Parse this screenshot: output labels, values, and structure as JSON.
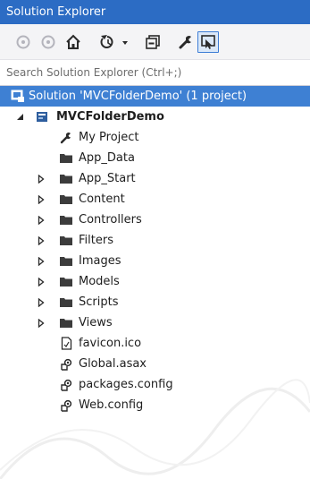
{
  "window": {
    "title": "Solution Explorer"
  },
  "toolbar": {
    "buttons": [
      {
        "icon": "back-icon"
      },
      {
        "icon": "forward-icon"
      },
      {
        "icon": "home-icon"
      },
      {
        "icon": "history-dropdown-icon"
      },
      {
        "icon": "collapse-all-icon"
      },
      {
        "icon": "properties-wrench-icon"
      },
      {
        "icon": "preview-selected-icon",
        "selected": true
      }
    ]
  },
  "search": {
    "placeholder": "Search Solution Explorer (Ctrl+;)"
  },
  "tree": {
    "solution": {
      "label": "Solution 'MVCFolderDemo' (1 project)"
    },
    "project": {
      "label": "MVCFolderDemo"
    },
    "items": [
      {
        "label": "My Project",
        "icon": "wrench-icon",
        "expandable": false
      },
      {
        "label": "App_Data",
        "icon": "folder-icon",
        "expandable": false
      },
      {
        "label": "App_Start",
        "icon": "folder-icon",
        "expandable": true
      },
      {
        "label": "Content",
        "icon": "folder-icon",
        "expandable": true
      },
      {
        "label": "Controllers",
        "icon": "folder-icon",
        "expandable": true
      },
      {
        "label": "Filters",
        "icon": "folder-icon",
        "expandable": true
      },
      {
        "label": "Images",
        "icon": "folder-icon",
        "expandable": true
      },
      {
        "label": "Models",
        "icon": "folder-icon",
        "expandable": true
      },
      {
        "label": "Scripts",
        "icon": "folder-icon",
        "expandable": true
      },
      {
        "label": "Views",
        "icon": "folder-icon",
        "expandable": true
      },
      {
        "label": "favicon.ico",
        "icon": "file-icon",
        "expandable": false
      },
      {
        "label": "Global.asax",
        "icon": "config-file-icon",
        "expandable": false
      },
      {
        "label": "packages.config",
        "icon": "config-file-icon",
        "expandable": false
      },
      {
        "label": "Web.config",
        "icon": "config-file-icon",
        "expandable": false
      }
    ]
  },
  "colors": {
    "titlebar": "#2c6cc4",
    "selection": "#3e80d3",
    "folder": "#3c3c3c"
  }
}
